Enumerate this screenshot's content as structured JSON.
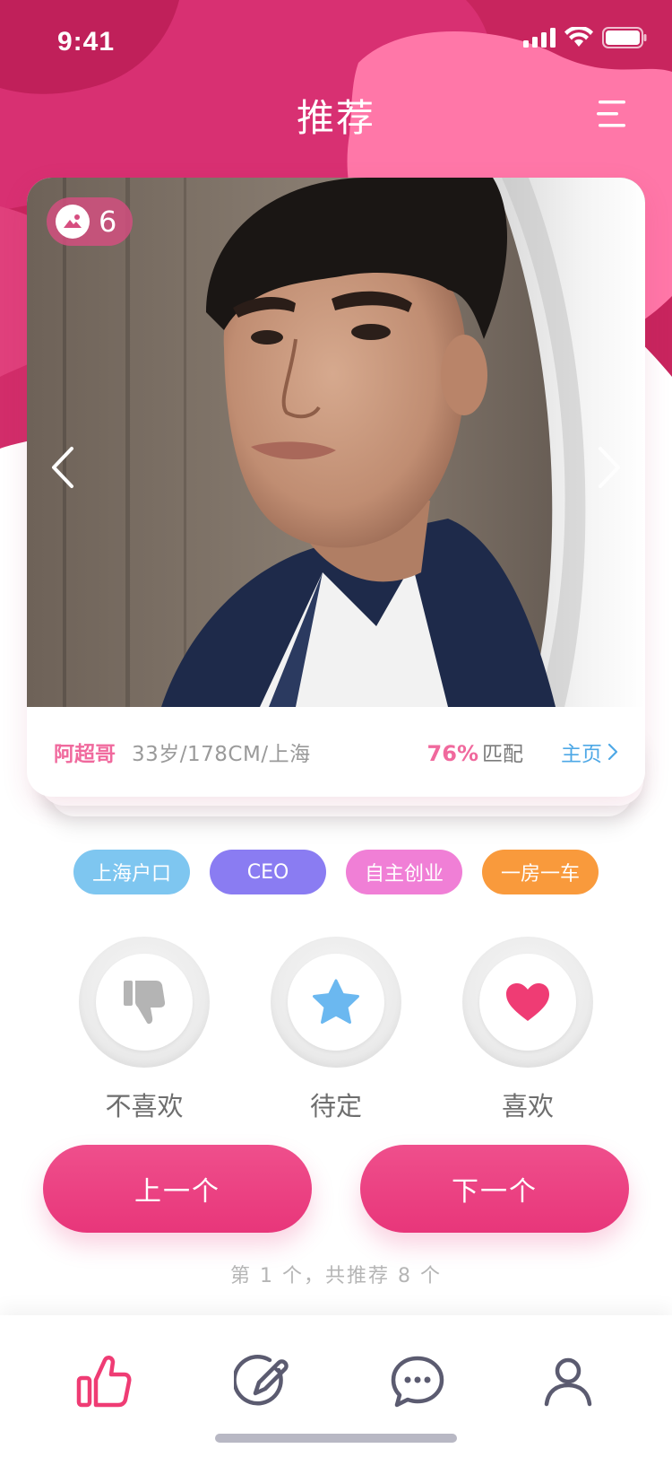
{
  "status_bar": {
    "time": "9:41"
  },
  "header": {
    "title": "推荐"
  },
  "card": {
    "photo_count": "6",
    "name": "阿超哥",
    "details": "33岁/178CM/上海",
    "match_percent": "76%",
    "match_label": "匹配",
    "homepage_link": "主页"
  },
  "tags": [
    {
      "label": "上海户口",
      "color": "#7ec6f0"
    },
    {
      "label": "CEO",
      "color": "#8a7cf2"
    },
    {
      "label": "自主创业",
      "color": "#f07fd6"
    },
    {
      "label": "一房一车",
      "color": "#f99a3c"
    }
  ],
  "actions": {
    "dislike": {
      "label": "不喜欢",
      "icon": "thumbs-down-icon",
      "color": "#b4b4b4"
    },
    "pending": {
      "label": "待定",
      "icon": "star-icon",
      "color": "#6bb8f0"
    },
    "like": {
      "label": "喜欢",
      "icon": "heart-icon",
      "color": "#ef3c74"
    }
  },
  "buttons": {
    "prev": "上一个",
    "next": "下一个"
  },
  "counter": "第 1 个，共推荐 8 个",
  "tab_bar": {
    "items": [
      {
        "icon": "thumbs-up-icon",
        "active": true
      },
      {
        "icon": "edit-icon",
        "active": false
      },
      {
        "icon": "chat-icon",
        "active": false
      },
      {
        "icon": "profile-icon",
        "active": false
      }
    ]
  },
  "colors": {
    "brand_pink": "#e8367a",
    "header_dark": "#c8255e",
    "header_light": "#ff77a8",
    "link_blue": "#4ea8e6"
  }
}
